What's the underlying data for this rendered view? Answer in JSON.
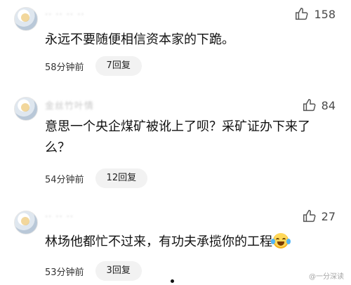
{
  "comments": [
    {
      "username": "·· ·· ·· ··",
      "likes": "158",
      "text": "永远不要随便相信资本家的下跪。",
      "time": "58分钟前",
      "replies": "7回复"
    },
    {
      "username": "金丝竹叶情",
      "likes": "84",
      "text": "意思一个央企煤矿被讹上了呗？采矿证办下来了么？",
      "time": "54分钟前",
      "replies": "12回复"
    },
    {
      "username": "·· ·· ··",
      "likes": "27",
      "text": "林场他都忙不过来，有功夫承揽你的工程",
      "time": "53分钟前",
      "replies": "3回复"
    }
  ],
  "watermark": {
    "text": "@一分深读"
  },
  "icons": {
    "like": "thumbs-up-icon",
    "emoji": "laugh-cry-emoji-icon",
    "avatar": "avatar"
  }
}
